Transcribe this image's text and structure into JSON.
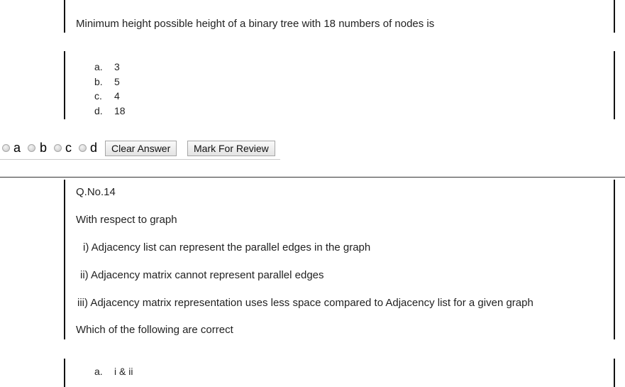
{
  "q13": {
    "text": "Minimum height possible height of a binary tree with 18 numbers of nodes is",
    "options": [
      {
        "letter": "a.",
        "text": "3"
      },
      {
        "letter": "b.",
        "text": "5"
      },
      {
        "letter": "c.",
        "text": "4"
      },
      {
        "letter": "d.",
        "text": "18"
      }
    ]
  },
  "answer_bar": {
    "radios": [
      "a",
      "b",
      "c",
      "d"
    ],
    "clear_label": "Clear Answer",
    "review_label": "Mark For Review"
  },
  "q14": {
    "number": "Q.No.14",
    "intro": "With respect to graph",
    "statements": [
      "i) Adjacency list can represent the parallel edges in the graph",
      "ii) Adjacency matrix cannot represent parallel edges",
      "iii) Adjacency matrix representation uses less space compared to Adjacency list for a given graph"
    ],
    "prompt": "Which of the following are correct",
    "options": [
      {
        "letter": "a.",
        "text": "i & ii"
      }
    ]
  }
}
